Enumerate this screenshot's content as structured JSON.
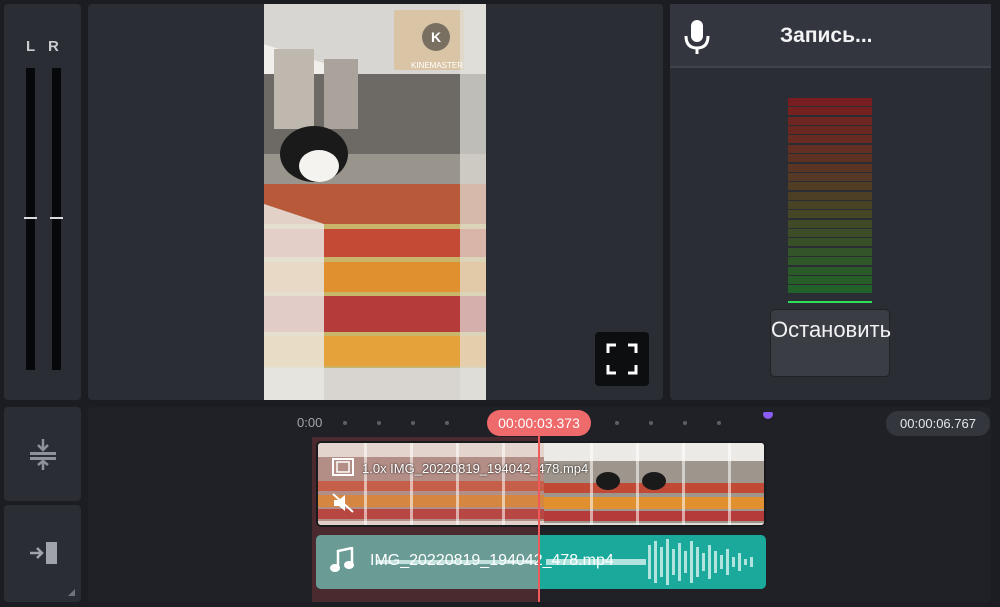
{
  "meter": {
    "left_label": "L",
    "right_label": "R"
  },
  "preview": {
    "watermark": "KINEMASTER",
    "fullscreen_icon": "fullscreen-icon"
  },
  "recording": {
    "title": "Запись...",
    "mic_icon": "microphone-icon",
    "stop_label": "Остановить",
    "level_segments": 22,
    "active_segments": 1
  },
  "tools": {
    "top_icon": "track-height-icon",
    "bottom_icon": "jump-to-end-icon"
  },
  "timeline": {
    "start_time": "0:00",
    "current_time": "00:00:03.373",
    "end_time": "00:00:06.767",
    "video_clip_label": "1.0x IMG_20220819_194042_478.mp4",
    "audio_clip_label": "IMG_20220819_194042_478.mp4",
    "colors": {
      "playhead": "#ef6a6a",
      "audio_clip": "#1aa99a",
      "marker": "#8b5cf6"
    }
  }
}
